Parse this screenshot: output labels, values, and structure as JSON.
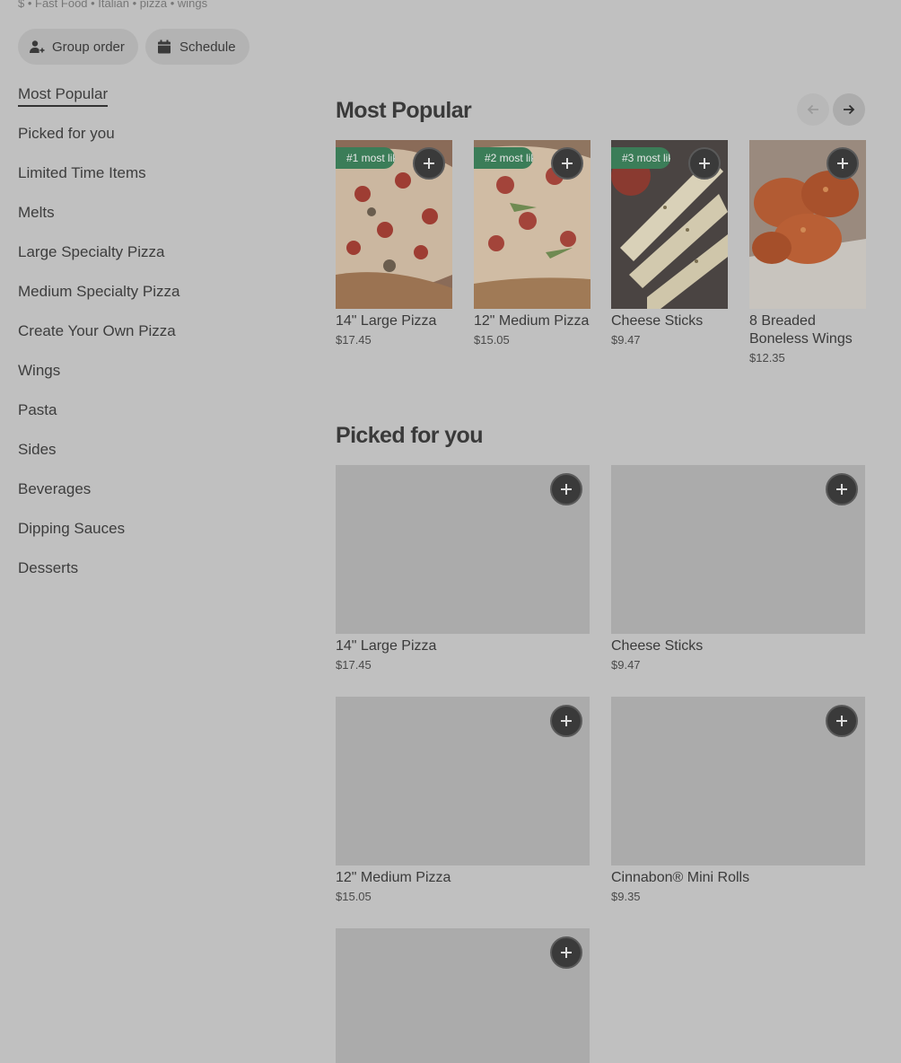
{
  "store": {
    "tags": "$ • Fast Food • Italian • pizza • wings"
  },
  "actions": {
    "group_order": "Group order",
    "schedule": "Schedule"
  },
  "nav": {
    "items": [
      {
        "label": "Most Popular",
        "active": true
      },
      {
        "label": "Picked for you"
      },
      {
        "label": "Limited Time Items"
      },
      {
        "label": "Melts"
      },
      {
        "label": "Large Specialty Pizza"
      },
      {
        "label": "Medium Specialty Pizza"
      },
      {
        "label": "Create Your Own Pizza"
      },
      {
        "label": "Wings"
      },
      {
        "label": "Pasta"
      },
      {
        "label": "Sides"
      },
      {
        "label": "Beverages"
      },
      {
        "label": "Dipping Sauces"
      },
      {
        "label": "Desserts"
      }
    ]
  },
  "most_popular": {
    "title": "Most Popular",
    "items": [
      {
        "badge": "#1 most liked",
        "name": "14\" Large Pizza",
        "price": "$17.45"
      },
      {
        "badge": "#2 most liked",
        "name": "12\" Medium Pizza",
        "price": "$15.05"
      },
      {
        "badge": "#3 most liked",
        "name": "Cheese Sticks",
        "price": "$9.47"
      },
      {
        "name": "8 Breaded Boneless Wings",
        "price": "$12.35"
      }
    ]
  },
  "picked_for_you": {
    "title": "Picked for you",
    "items": [
      {
        "name": "14\" Large Pizza",
        "price": "$17.45"
      },
      {
        "name": "Cheese Sticks",
        "price": "$9.47"
      },
      {
        "name": "12\" Medium Pizza",
        "price": "$15.05"
      },
      {
        "name": "Cinnabon® Mini Rolls",
        "price": "$9.35"
      },
      {
        "name": "",
        "price": ""
      }
    ]
  },
  "icons": {
    "group": "person-add-icon",
    "schedule": "calendar-icon",
    "prev": "arrow-left-icon",
    "next": "arrow-right-icon",
    "add": "plus-icon"
  },
  "colors": {
    "badge": "#3b7d58",
    "add_button": "#3a3a3a"
  }
}
